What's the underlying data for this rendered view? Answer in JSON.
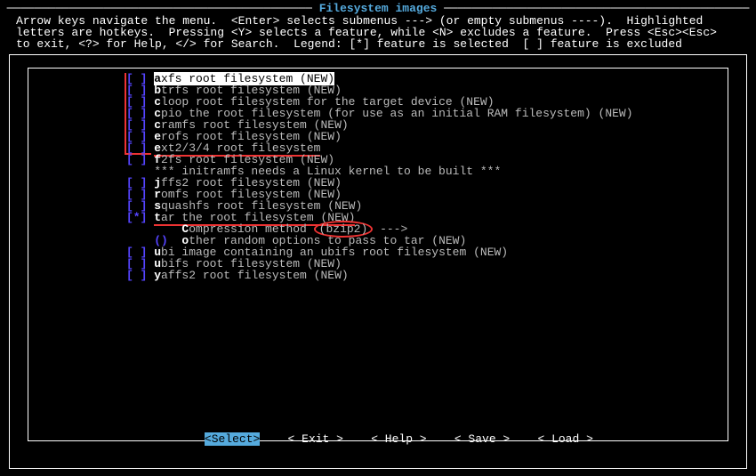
{
  "title": "Filesystem images",
  "help": "Arrow keys navigate the menu.  <Enter> selects submenus ---> (or empty submenus ----).  Highlighted\nletters are hotkeys.  Pressing <Y> selects a feature, while <N> excludes a feature.  Press <Esc><Esc>\nto exit, <?> for Help, </> for Search.  Legend: [*] feature is selected  [ ] feature is excluded",
  "items": [
    {
      "mark": "[ ]",
      "hk": "a",
      "rest": "xfs root filesystem (NEW)",
      "selected": true,
      "type": "check"
    },
    {
      "mark": "[ ]",
      "hk": "b",
      "rest": "trfs root filesystem (NEW)",
      "type": "check"
    },
    {
      "mark": "[ ]",
      "hk": "c",
      "rest": "loop root filesystem for the target device (NEW)",
      "type": "check"
    },
    {
      "mark": "[ ]",
      "hk": "c",
      "rest": "pio the root filesystem (for use as an initial RAM filesystem) (NEW)",
      "type": "check"
    },
    {
      "mark": "[ ]",
      "hk": "c",
      "rest": "ramfs root filesystem (NEW)",
      "type": "check"
    },
    {
      "mark": "[ ]",
      "hk": "e",
      "rest": "rofs root filesystem (NEW)",
      "type": "check"
    },
    {
      "mark": "[ ]",
      "hk": "e",
      "rest": "xt2/3/4 root filesystem",
      "type": "check",
      "underline": true
    },
    {
      "mark": "[ ]",
      "hk": "f",
      "rest": "2fs root filesystem (NEW)",
      "type": "check"
    },
    {
      "mark": "   ",
      "hk": "",
      "rest": "*** initramfs needs a Linux kernel to be built ***",
      "type": "info"
    },
    {
      "mark": "[ ]",
      "hk": "j",
      "rest": "ffs2 root filesystem (NEW)",
      "type": "check"
    },
    {
      "mark": "[ ]",
      "hk": "r",
      "rest": "omfs root filesystem (NEW)",
      "type": "check"
    },
    {
      "mark": "[ ]",
      "hk": "s",
      "rest": "quashfs root filesystem (NEW)",
      "type": "check"
    },
    {
      "mark": "[*]",
      "hk": "t",
      "rest": "ar the root filesystem (NEW)",
      "type": "check",
      "underline": true
    },
    {
      "mark": "   ",
      "hk": "C",
      "rest": "ompression method ",
      "tail": " --->",
      "circle": "(bzip2)",
      "type": "submenu",
      "indent": "    "
    },
    {
      "mark": "() ",
      "hk": "o",
      "rest": "ther random options to pass to tar (NEW)",
      "type": "string",
      "indent": "    "
    },
    {
      "mark": "[ ]",
      "hk": "u",
      "rest": "bi image containing an ubifs root filesystem (NEW)",
      "type": "check"
    },
    {
      "mark": "[ ]",
      "hk": "u",
      "rest": "bifs root filesystem (NEW)",
      "type": "check"
    },
    {
      "mark": "[ ]",
      "hk": "y",
      "rest": "affs2 root filesystem (NEW)",
      "type": "check"
    }
  ],
  "buttons": {
    "select": "<Select>",
    "exit": "< Exit >",
    "help": "< Help >",
    "save": "< Save >",
    "load": "< Load >"
  }
}
